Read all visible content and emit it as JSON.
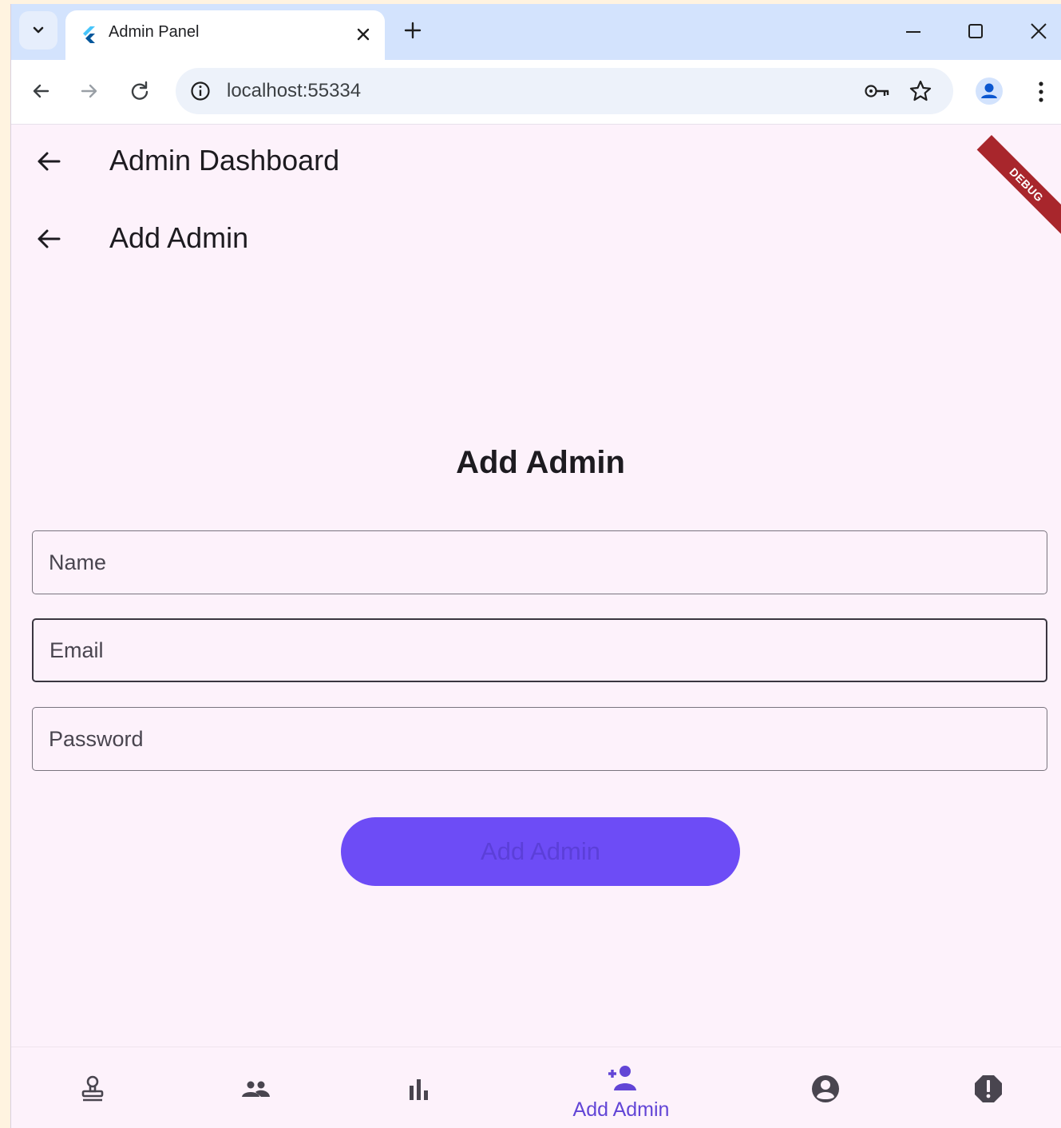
{
  "browser": {
    "tab_title": "Admin Panel",
    "url": "localhost:55334"
  },
  "app": {
    "appbars": [
      {
        "title": "Admin Dashboard"
      },
      {
        "title": "Add Admin"
      }
    ],
    "debug_banner": "DEBUG",
    "form": {
      "heading": "Add Admin",
      "fields": [
        {
          "placeholder": "Name",
          "value": ""
        },
        {
          "placeholder": "Email",
          "value": ""
        },
        {
          "placeholder": "Password",
          "value": ""
        }
      ],
      "submit_label": "Add Admin"
    },
    "bottom_nav": {
      "items": [
        {
          "icon": "stamp-icon",
          "label": ""
        },
        {
          "icon": "people-icon",
          "label": ""
        },
        {
          "icon": "bar-chart-icon",
          "label": ""
        },
        {
          "icon": "person-add-icon",
          "label": "Add Admin",
          "active": true
        },
        {
          "icon": "account-circle-icon",
          "label": ""
        },
        {
          "icon": "alert-icon",
          "label": ""
        }
      ]
    }
  },
  "colors": {
    "accent": "#6d4cf6",
    "nav_active": "#6245d6",
    "background": "#fdf2fb",
    "debug_ribbon": "#a8262c"
  }
}
